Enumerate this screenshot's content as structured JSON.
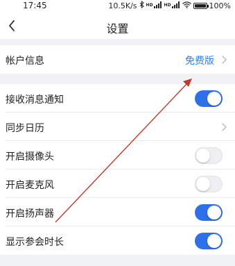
{
  "status_bar": {
    "time": "17:45",
    "speed": "10.5K/s",
    "battery": "100%",
    "battery_level": 1.0,
    "icons": [
      "bluetooth-icon",
      "hd-icon",
      "signal-icon",
      "wifi-icon",
      "battery-icon"
    ],
    "hd_label_1": "HD",
    "hd_label_2": "HD"
  },
  "nav": {
    "title": "设置",
    "back_icon": "chevron-left-icon"
  },
  "account": {
    "label": "帐户信息",
    "value": "免费版"
  },
  "settings": [
    {
      "label": "接收消息通知",
      "control": "toggle",
      "on": true
    },
    {
      "label": "同步日历",
      "control": "chevron"
    },
    {
      "label": "开启摄像头",
      "control": "toggle",
      "on": false
    },
    {
      "label": "开启麦克风",
      "control": "toggle",
      "on": false
    },
    {
      "label": "开启扬声器",
      "control": "toggle",
      "on": true
    },
    {
      "label": "显示参会时长",
      "control": "toggle",
      "on": true
    }
  ],
  "colors": {
    "accent": "#2f6fe8",
    "link": "#2f80ed",
    "background": "#f1f2f6",
    "annotation_arrow": "#c0392b"
  }
}
